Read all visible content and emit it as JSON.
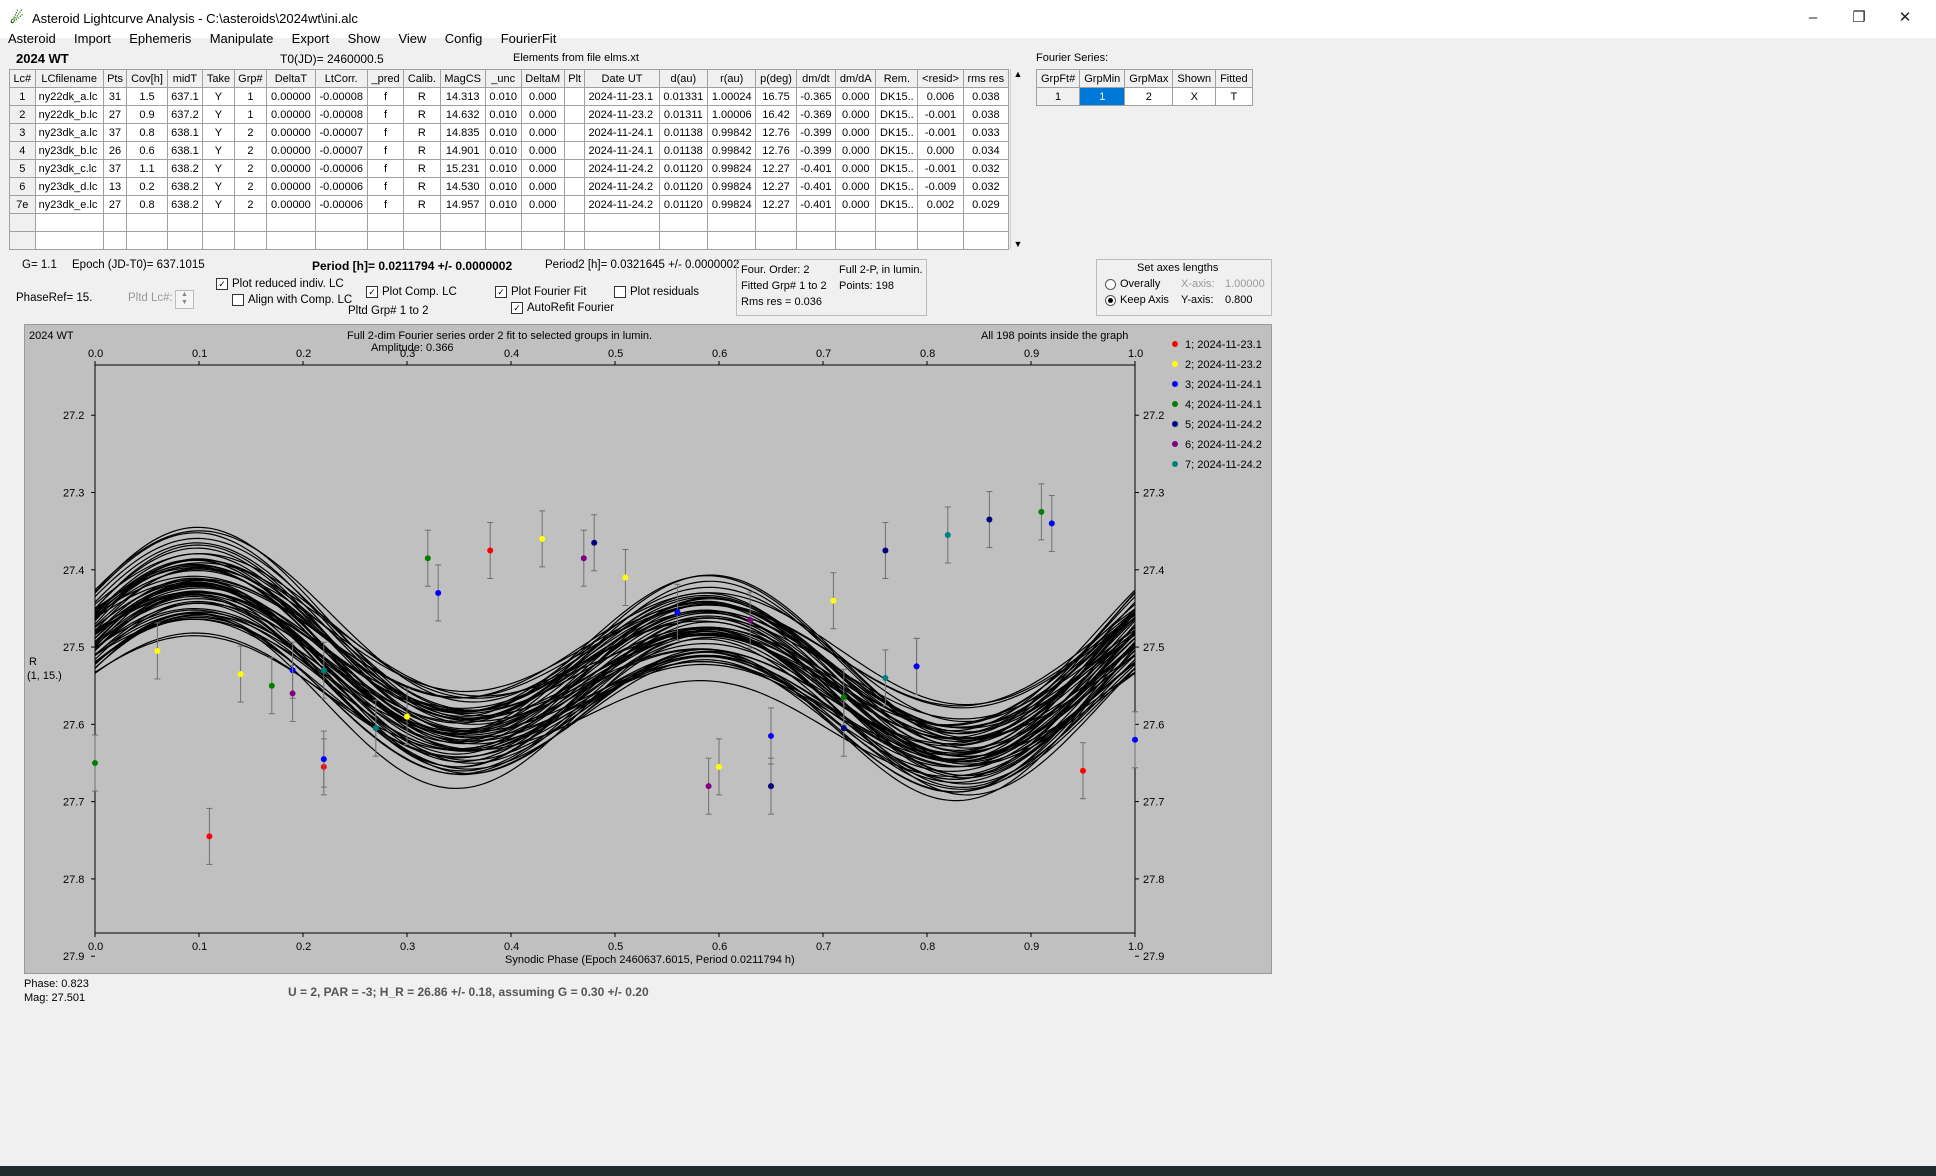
{
  "window": {
    "title": "Asteroid Lightcurve Analysis - C:\\asteroids\\2024wt\\ini.alc",
    "minimize": "–",
    "restore": "❐",
    "close": "✕"
  },
  "menu": [
    "Asteroid",
    "Import",
    "Ephemeris",
    "Manipulate",
    "Export",
    "Show",
    "View",
    "Config",
    "FourierFit"
  ],
  "header": {
    "object": "2024 WT",
    "t0": "T0(JD)= 2460000.5",
    "elements": "Elements from file elms.xt",
    "fourier_series": "Fourier Series:"
  },
  "lc_table": {
    "columns": [
      "Lc#",
      "LCfilename",
      "Pts",
      "Cov[h]",
      "midT",
      "Take",
      "Grp#",
      "DeltaT",
      "LtCorr.",
      "_pred",
      "Calib.",
      "MagCS",
      "_unc",
      "DeltaM",
      "Plt",
      "Date UT",
      "d(au)",
      "r(au)",
      "p(deg)",
      "dm/dt",
      "dm/dA",
      "Rem.",
      "<resid>",
      "rms res"
    ],
    "rows": [
      [
        "1",
        "ny22dk_a.lc",
        "31",
        "1.5",
        "637.1",
        "Y",
        "1",
        "0.00000",
        "-0.00008",
        "f",
        "R",
        "14.313",
        "0.010",
        "0.000",
        "",
        "2024-11-23.1",
        "0.01331",
        "1.00024",
        "16.75",
        "-0.365",
        "0.000",
        "DK15..",
        "0.006",
        "0.038"
      ],
      [
        "2",
        "ny22dk_b.lc",
        "27",
        "0.9",
        "637.2",
        "Y",
        "1",
        "0.00000",
        "-0.00008",
        "f",
        "R",
        "14.632",
        "0.010",
        "0.000",
        "",
        "2024-11-23.2",
        "0.01311",
        "1.00006",
        "16.42",
        "-0.369",
        "0.000",
        "DK15..",
        "-0.001",
        "0.038"
      ],
      [
        "3",
        "ny23dk_a.lc",
        "37",
        "0.8",
        "638.1",
        "Y",
        "2",
        "0.00000",
        "-0.00007",
        "f",
        "R",
        "14.835",
        "0.010",
        "0.000",
        "",
        "2024-11-24.1",
        "0.01138",
        "0.99842",
        "12.76",
        "-0.399",
        "0.000",
        "DK15..",
        "-0.001",
        "0.033"
      ],
      [
        "4",
        "ny23dk_b.lc",
        "26",
        "0.6",
        "638.1",
        "Y",
        "2",
        "0.00000",
        "-0.00007",
        "f",
        "R",
        "14.901",
        "0.010",
        "0.000",
        "",
        "2024-11-24.1",
        "0.01138",
        "0.99842",
        "12.76",
        "-0.399",
        "0.000",
        "DK15..",
        "0.000",
        "0.034"
      ],
      [
        "5",
        "ny23dk_c.lc",
        "37",
        "1.1",
        "638.2",
        "Y",
        "2",
        "0.00000",
        "-0.00006",
        "f",
        "R",
        "15.231",
        "0.010",
        "0.000",
        "",
        "2024-11-24.2",
        "0.01120",
        "0.99824",
        "12.27",
        "-0.401",
        "0.000",
        "DK15..",
        "-0.001",
        "0.032"
      ],
      [
        "6",
        "ny23dk_d.lc",
        "13",
        "0.2",
        "638.2",
        "Y",
        "2",
        "0.00000",
        "-0.00006",
        "f",
        "R",
        "14.530",
        "0.010",
        "0.000",
        "",
        "2024-11-24.2",
        "0.01120",
        "0.99824",
        "12.27",
        "-0.401",
        "0.000",
        "DK15..",
        "-0.009",
        "0.032"
      ],
      [
        "7e",
        "ny23dk_e.lc",
        "27",
        "0.8",
        "638.2",
        "Y",
        "2",
        "0.00000",
        "-0.00006",
        "f",
        "R",
        "14.957",
        "0.010",
        "0.000",
        "",
        "2024-11-24.2",
        "0.01120",
        "0.99824",
        "12.27",
        "-0.401",
        "0.000",
        "DK15..",
        "0.002",
        "0.029"
      ]
    ]
  },
  "fourier_table": {
    "columns": [
      "GrpFt#",
      "GrpMin",
      "GrpMax",
      "Shown",
      "Fitted"
    ],
    "row": [
      "1",
      "1",
      "2",
      "X",
      "T"
    ]
  },
  "controls": {
    "g": "G= 1.1",
    "epoch": "Epoch (JD-T0)= 637.1015",
    "period": "Period [h]= 0.0211794 +/- 0.0000002",
    "period2": "Period2 [h]= 0.0321645 +/- 0.0000002",
    "phaseref": "PhaseRef= 15.",
    "pltd_lc": "Pltd Lc#:",
    "plot_reduced": "Plot reduced indiv. LC",
    "align_comp": "Align with Comp. LC",
    "plot_comp": "Plot Comp. LC",
    "pltd_grp": "Pltd Grp#  1   to   2",
    "plot_fourier": "Plot Fourier Fit",
    "autorefit": "AutoRefit Fourier",
    "plot_residuals": "Plot residuals",
    "info": {
      "four_order": "Four. Order:  2",
      "full2p": "Full 2-P, in lumin.",
      "fitted_grp": "Fitted Grp# 1 to 2",
      "points": "Points: 198",
      "rms": "Rms res     = 0.036"
    },
    "axes": {
      "title": "Set axes lengths",
      "overally": "Overally",
      "xaxis": "X-axis:",
      "xval": "1.00000",
      "keep": "Keep Axis",
      "yaxis": "Y-axis:",
      "yval": "0.800"
    }
  },
  "chart_data": {
    "type": "scatter",
    "object": "2024 WT",
    "title": "Full 2-dim Fourier series order 2 fit to selected groups in lumin.",
    "subtitle": "Amplitude: 0.366",
    "note": "All 198 points inside the graph",
    "xlabel": "Synodic Phase (Epoch 2460637.6015, Period 0.0211794 h)",
    "ylabel": "R",
    "ylabel2": "(1, 15.)",
    "xlim": [
      0,
      1
    ],
    "ylim": [
      27.9,
      27.1
    ],
    "xticks": [
      "0.0",
      "0.1",
      "0.2",
      "0.3",
      "0.4",
      "0.5",
      "0.6",
      "0.7",
      "0.8",
      "0.9",
      "1.0"
    ],
    "yticks": [
      "27.2",
      "27.3",
      "27.4",
      "27.5",
      "27.6",
      "27.7",
      "27.8",
      "27.9"
    ],
    "series": [
      {
        "name": "1; 2024-11-23.1",
        "color": "#ff0000",
        "points": [
          [
            0.11,
            27.745
          ],
          [
            0.22,
            27.655
          ],
          [
            0.38,
            27.375
          ],
          [
            0.79,
            27.525
          ],
          [
            0.95,
            27.66
          ]
        ]
      },
      {
        "name": "2; 2024-11-23.2",
        "color": "#ffff00",
        "points": [
          [
            0.06,
            27.505
          ],
          [
            0.14,
            27.535
          ],
          [
            0.3,
            27.59
          ],
          [
            0.43,
            27.36
          ],
          [
            0.51,
            27.41
          ],
          [
            0.6,
            27.655
          ],
          [
            0.71,
            27.44
          ]
        ]
      },
      {
        "name": "3; 2024-11-24.1",
        "color": "#0000ff",
        "points": [
          [
            0.19,
            27.53
          ],
          [
            0.22,
            27.645
          ],
          [
            0.33,
            27.43
          ],
          [
            0.56,
            27.455
          ],
          [
            0.65,
            27.615
          ],
          [
            0.79,
            27.525
          ],
          [
            0.92,
            27.34
          ],
          [
            1.0,
            27.62
          ]
        ]
      },
      {
        "name": "4; 2024-11-24.1",
        "color": "#008000",
        "points": [
          [
            0.0,
            27.65
          ],
          [
            0.17,
            27.55
          ],
          [
            0.32,
            27.385
          ],
          [
            0.72,
            27.565
          ],
          [
            0.91,
            27.325
          ]
        ]
      },
      {
        "name": "5; 2024-11-24.2",
        "color": "#000080",
        "points": [
          [
            0.48,
            27.365
          ],
          [
            0.65,
            27.68
          ],
          [
            0.72,
            27.605
          ],
          [
            0.76,
            27.375
          ],
          [
            0.86,
            27.335
          ]
        ]
      },
      {
        "name": "6; 2024-11-24.2",
        "color": "#800080",
        "points": [
          [
            0.19,
            27.56
          ],
          [
            0.47,
            27.385
          ],
          [
            0.59,
            27.68
          ],
          [
            0.63,
            27.465
          ]
        ]
      },
      {
        "name": "7; 2024-11-24.2",
        "color": "#008080",
        "points": [
          [
            0.22,
            27.53
          ],
          [
            0.27,
            27.605
          ],
          [
            0.76,
            27.54
          ],
          [
            0.82,
            27.355
          ]
        ]
      }
    ],
    "fourier_curve": {
      "mean": 27.535,
      "amplitude": 0.366,
      "band_width": 0.08
    }
  },
  "status": {
    "phase": "Phase:  0.823",
    "mag": "Mag:    27.501",
    "result": "U = 2, PAR = -3; H_R = 26.86 +/- 0.18, assuming G = 0.30 +/- 0.20"
  }
}
